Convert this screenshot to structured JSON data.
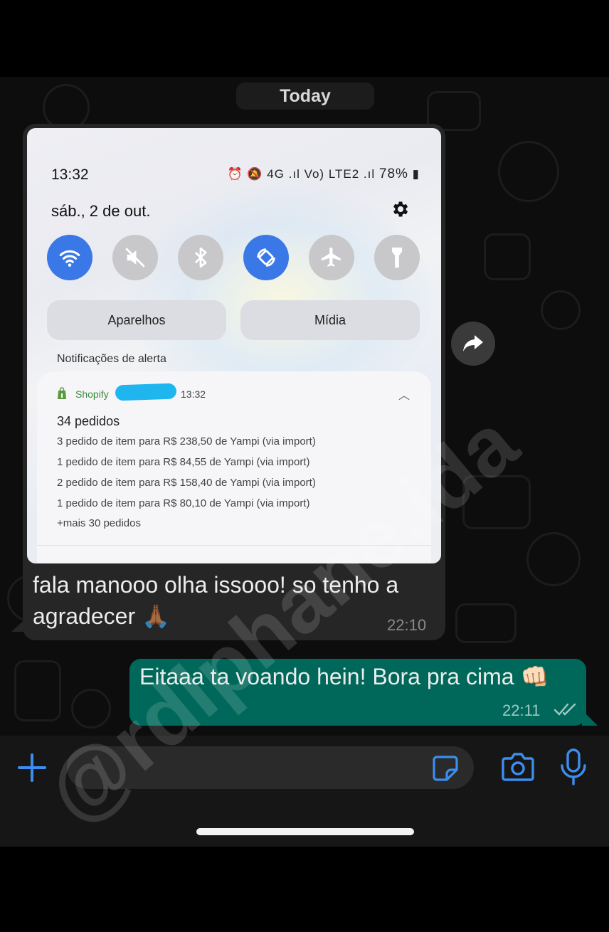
{
  "date_separator": "Today",
  "screenshot": {
    "status_time": "13:32",
    "status_icons": "⏰ 🔕 4G .ıl Vo) LTE2 .ıl",
    "battery": "78%",
    "date": "sáb., 2 de out.",
    "quick_settings": [
      {
        "name": "wifi",
        "active": true
      },
      {
        "name": "sound-off",
        "active": false
      },
      {
        "name": "bluetooth",
        "active": false
      },
      {
        "name": "auto-rotate",
        "active": true
      },
      {
        "name": "airplane",
        "active": false
      },
      {
        "name": "flashlight",
        "active": false
      }
    ],
    "buttons": {
      "devices": "Aparelhos",
      "media": "Mídia"
    },
    "alert_label": "Notificações de alerta",
    "notification": {
      "app": "Shopify",
      "time": "13:32",
      "title": "34 pedidos",
      "lines": [
        "3 pedido de item para R$ 238,50 de Yampi (via import)",
        "1 pedido de item para R$ 84,55 de Yampi (via import)",
        "2 pedido de item para R$ 158,40 de Yampi (via import)",
        "1 pedido de item para R$ 80,10 de Yampi (via import)",
        "+mais 30 pedidos"
      ]
    }
  },
  "incoming": {
    "text": "fala manooo olha issooo! so tenho a agradecer 🙏🏾",
    "time": "22:10"
  },
  "outgoing": {
    "text": "Eitaaa ta voando hein! Bora pra cima 👊🏻",
    "time": "22:11"
  },
  "watermark": "@rdlphane.ida",
  "colors": {
    "outgoing_bubble": "#00685a",
    "incoming_bubble": "#262626",
    "accent": "#3b8ef0",
    "quick_setting_active": "#3b78e7"
  }
}
